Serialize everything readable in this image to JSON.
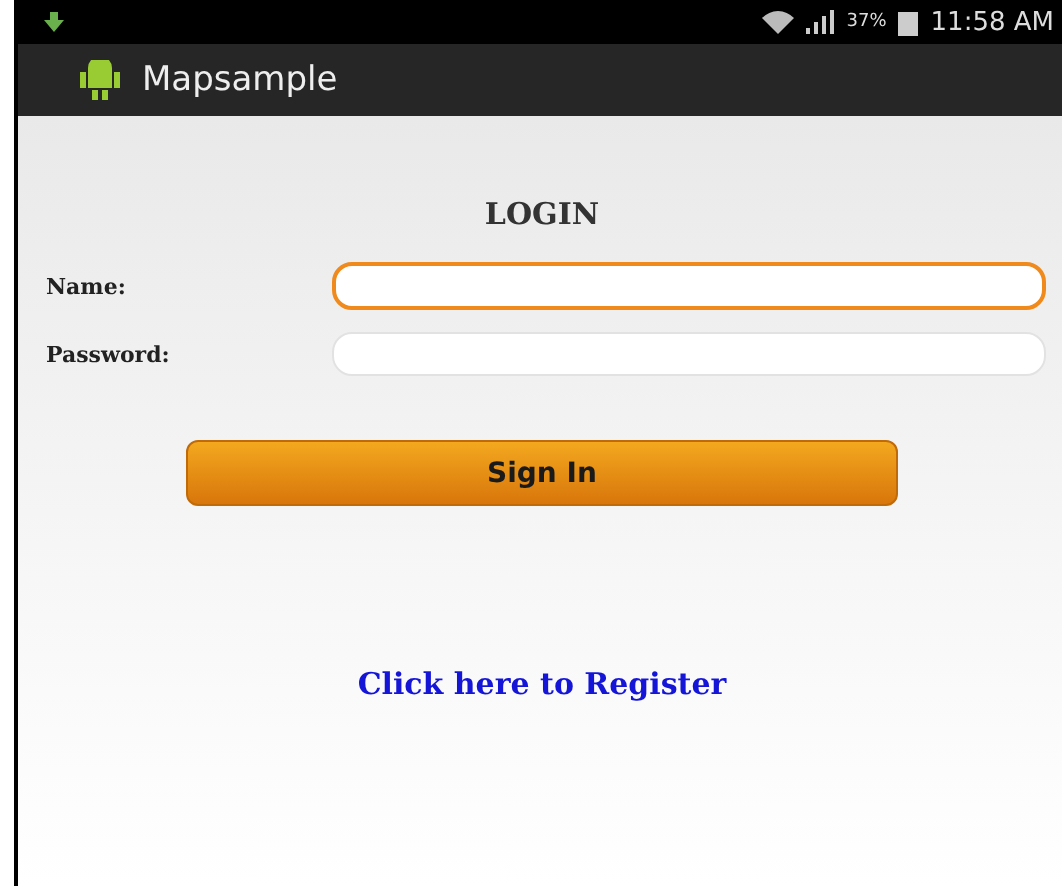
{
  "status_bar": {
    "battery": "37%",
    "time": "11:58 AM"
  },
  "action_bar": {
    "title": "Mapsample"
  },
  "form": {
    "heading": "LOGIN",
    "fields": [
      {
        "label": "Name:",
        "focused": true
      },
      {
        "label": "Password:",
        "focused": false
      }
    ],
    "button": "Sign In"
  },
  "register_link": "Click here to Register"
}
